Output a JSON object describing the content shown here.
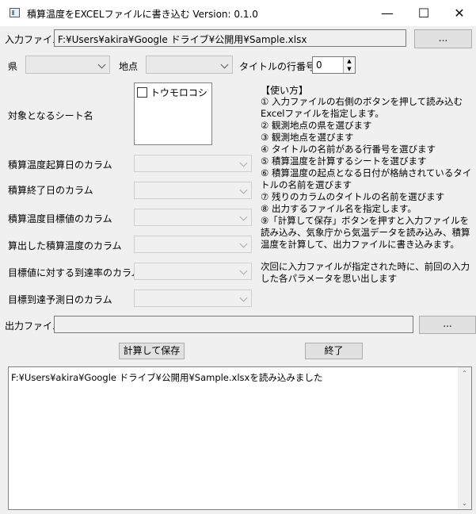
{
  "window": {
    "title": "積算温度をEXCELファイルに書き込む  Version: 0.1.0",
    "minimize": "—",
    "maximize": "☐",
    "close": "✕"
  },
  "input_file": {
    "label": "入力ファイル",
    "value": "F:¥Users¥akira¥Google ドライブ¥公開用¥Sample.xlsx",
    "browse_label": "..."
  },
  "prefecture": {
    "label": "県",
    "value": ""
  },
  "location": {
    "label": "地点",
    "value": ""
  },
  "title_row": {
    "label": "タイトルの行番号",
    "value": "0"
  },
  "sheet": {
    "label": "対象となるシート名",
    "items": [
      {
        "label": "トウモロコシ",
        "checked": false
      }
    ]
  },
  "columns": [
    {
      "label": "積算温度起算日のカラム",
      "value": ""
    },
    {
      "label": "積算終了日のカラム",
      "value": ""
    },
    {
      "label": "積算温度目標値のカラム",
      "value": ""
    },
    {
      "label": "算出した積算温度のカラム",
      "value": ""
    },
    {
      "label": "目標値に対する到達率のカラム",
      "value": ""
    },
    {
      "label": "目標到達予測日のカラム",
      "value": ""
    }
  ],
  "howto": {
    "title": "【使い方】",
    "body": "① 入力ファイルの右側のボタンを押して読み込むExcelファイルを指定します。\n② 観測地点の県を選びます\n③ 観測地点を選びます\n④ タイトルの名前がある行番号を選びます\n⑤ 積算温度を計算するシートを選びます\n⑥ 積算温度の起点となる日付が格納されているタイトルの名前を選びます\n⑦ 残りのカラムのタイトルの名前を選びます\n⑧ 出力するファイル名を指定します。\n⑨「計算して保存」ボタンを押すと入力ファイルを読み込み、気象庁から気温データを読み込み、積算温度を計算して、出力ファイルに書き込みます。",
    "note": "次回に入力ファイルが指定された時に、前回の入力した各パラメータを思い出します"
  },
  "output_file": {
    "label": "出力ファイル",
    "value": "",
    "browse_label": "..."
  },
  "actions": {
    "calculate_save": "計算して保存",
    "exit": "終了"
  },
  "log": {
    "text": "F:¥Users¥akira¥Google ドライブ¥公開用¥Sample.xlsxを読み込みました"
  }
}
